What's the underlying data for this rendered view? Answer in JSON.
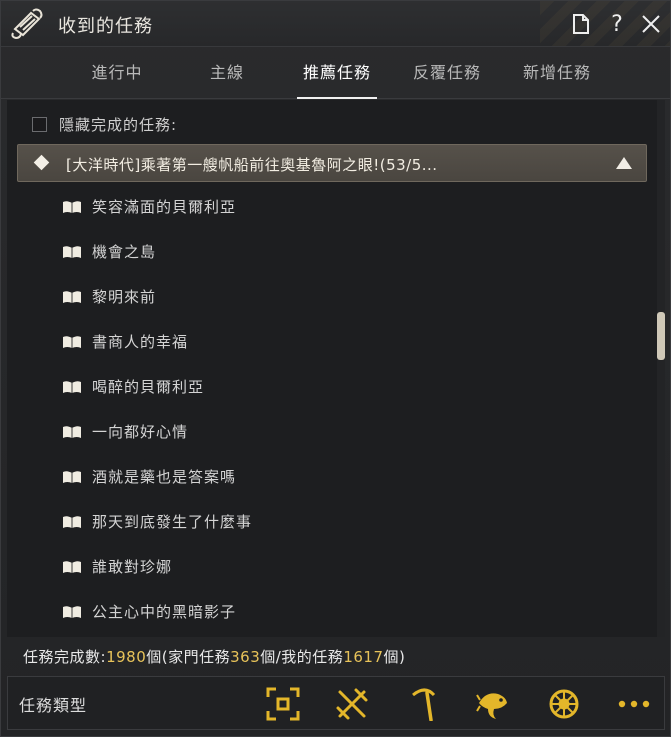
{
  "window": {
    "title": "收到的任務",
    "buttons": {
      "page_icon": "page-icon",
      "help_label": "?",
      "close_icon": "close-icon"
    }
  },
  "tabs": [
    {
      "label": "進行中"
    },
    {
      "label": "主線"
    },
    {
      "label": "推薦任務",
      "active": true
    },
    {
      "label": "反覆任務"
    },
    {
      "label": "新增任務"
    }
  ],
  "filter": {
    "hide_completed_label": "隱藏完成的任務:",
    "checked": false
  },
  "group": {
    "title": "[大洋時代]乘著第一艘帆船前往奧基魯阿之眼!(53/5...",
    "expanded": true
  },
  "quests": [
    {
      "name": "笑容滿面的貝爾利亞"
    },
    {
      "name": "機會之島"
    },
    {
      "name": "黎明來前"
    },
    {
      "name": "書商人的幸福"
    },
    {
      "name": "喝醉的貝爾利亞"
    },
    {
      "name": "一向都好心情"
    },
    {
      "name": "酒就是藥也是答案嗎"
    },
    {
      "name": "那天到底發生了什麼事"
    },
    {
      "name": "誰敢對珍娜"
    },
    {
      "name": "公主心中的黑暗影子"
    }
  ],
  "summary": {
    "label": "任務完成數:",
    "total": "1980",
    "unit1": "個(家門任務",
    "family": "363",
    "unit2": "個/我的任務",
    "mine": "1617",
    "unit3": "個)"
  },
  "footer": {
    "label": "任務類型",
    "icons": [
      "target-icon",
      "crossed-swords-icon",
      "pickaxe-icon",
      "fish-icon",
      "ship-wheel-icon",
      "more-icon"
    ]
  },
  "colors": {
    "accent_gold": "#e8c35a",
    "icon_gold": "#e3b62a"
  }
}
